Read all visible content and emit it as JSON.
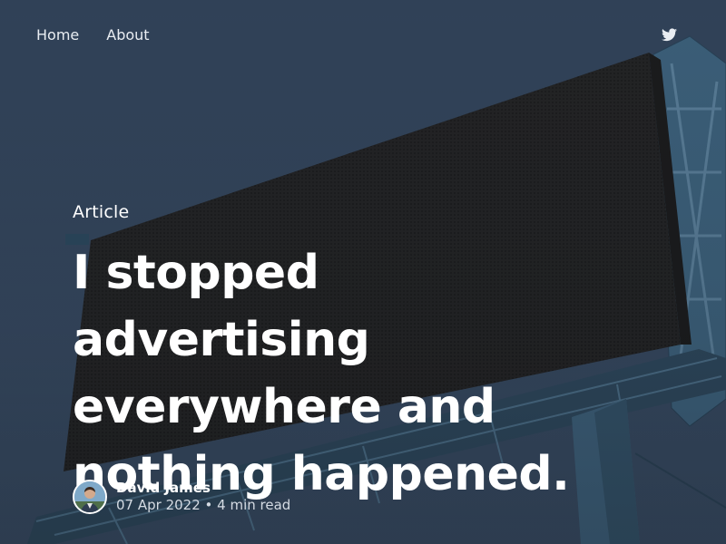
{
  "nav": {
    "items": [
      "Home",
      "About"
    ]
  },
  "social": {
    "icon": "twitter-icon"
  },
  "hero": {
    "kicker": "Article",
    "title_lines": [
      "I stopped advertising",
      "everywhere and",
      "nothing happened."
    ]
  },
  "author": {
    "name": "David James",
    "date": "07 Apr 2022",
    "separator": "•",
    "read_time": "4 min read"
  },
  "colors": {
    "sky": "#34475e",
    "billboard_face": "#242424",
    "steel": "#3f6580",
    "text": "#ffffff"
  }
}
